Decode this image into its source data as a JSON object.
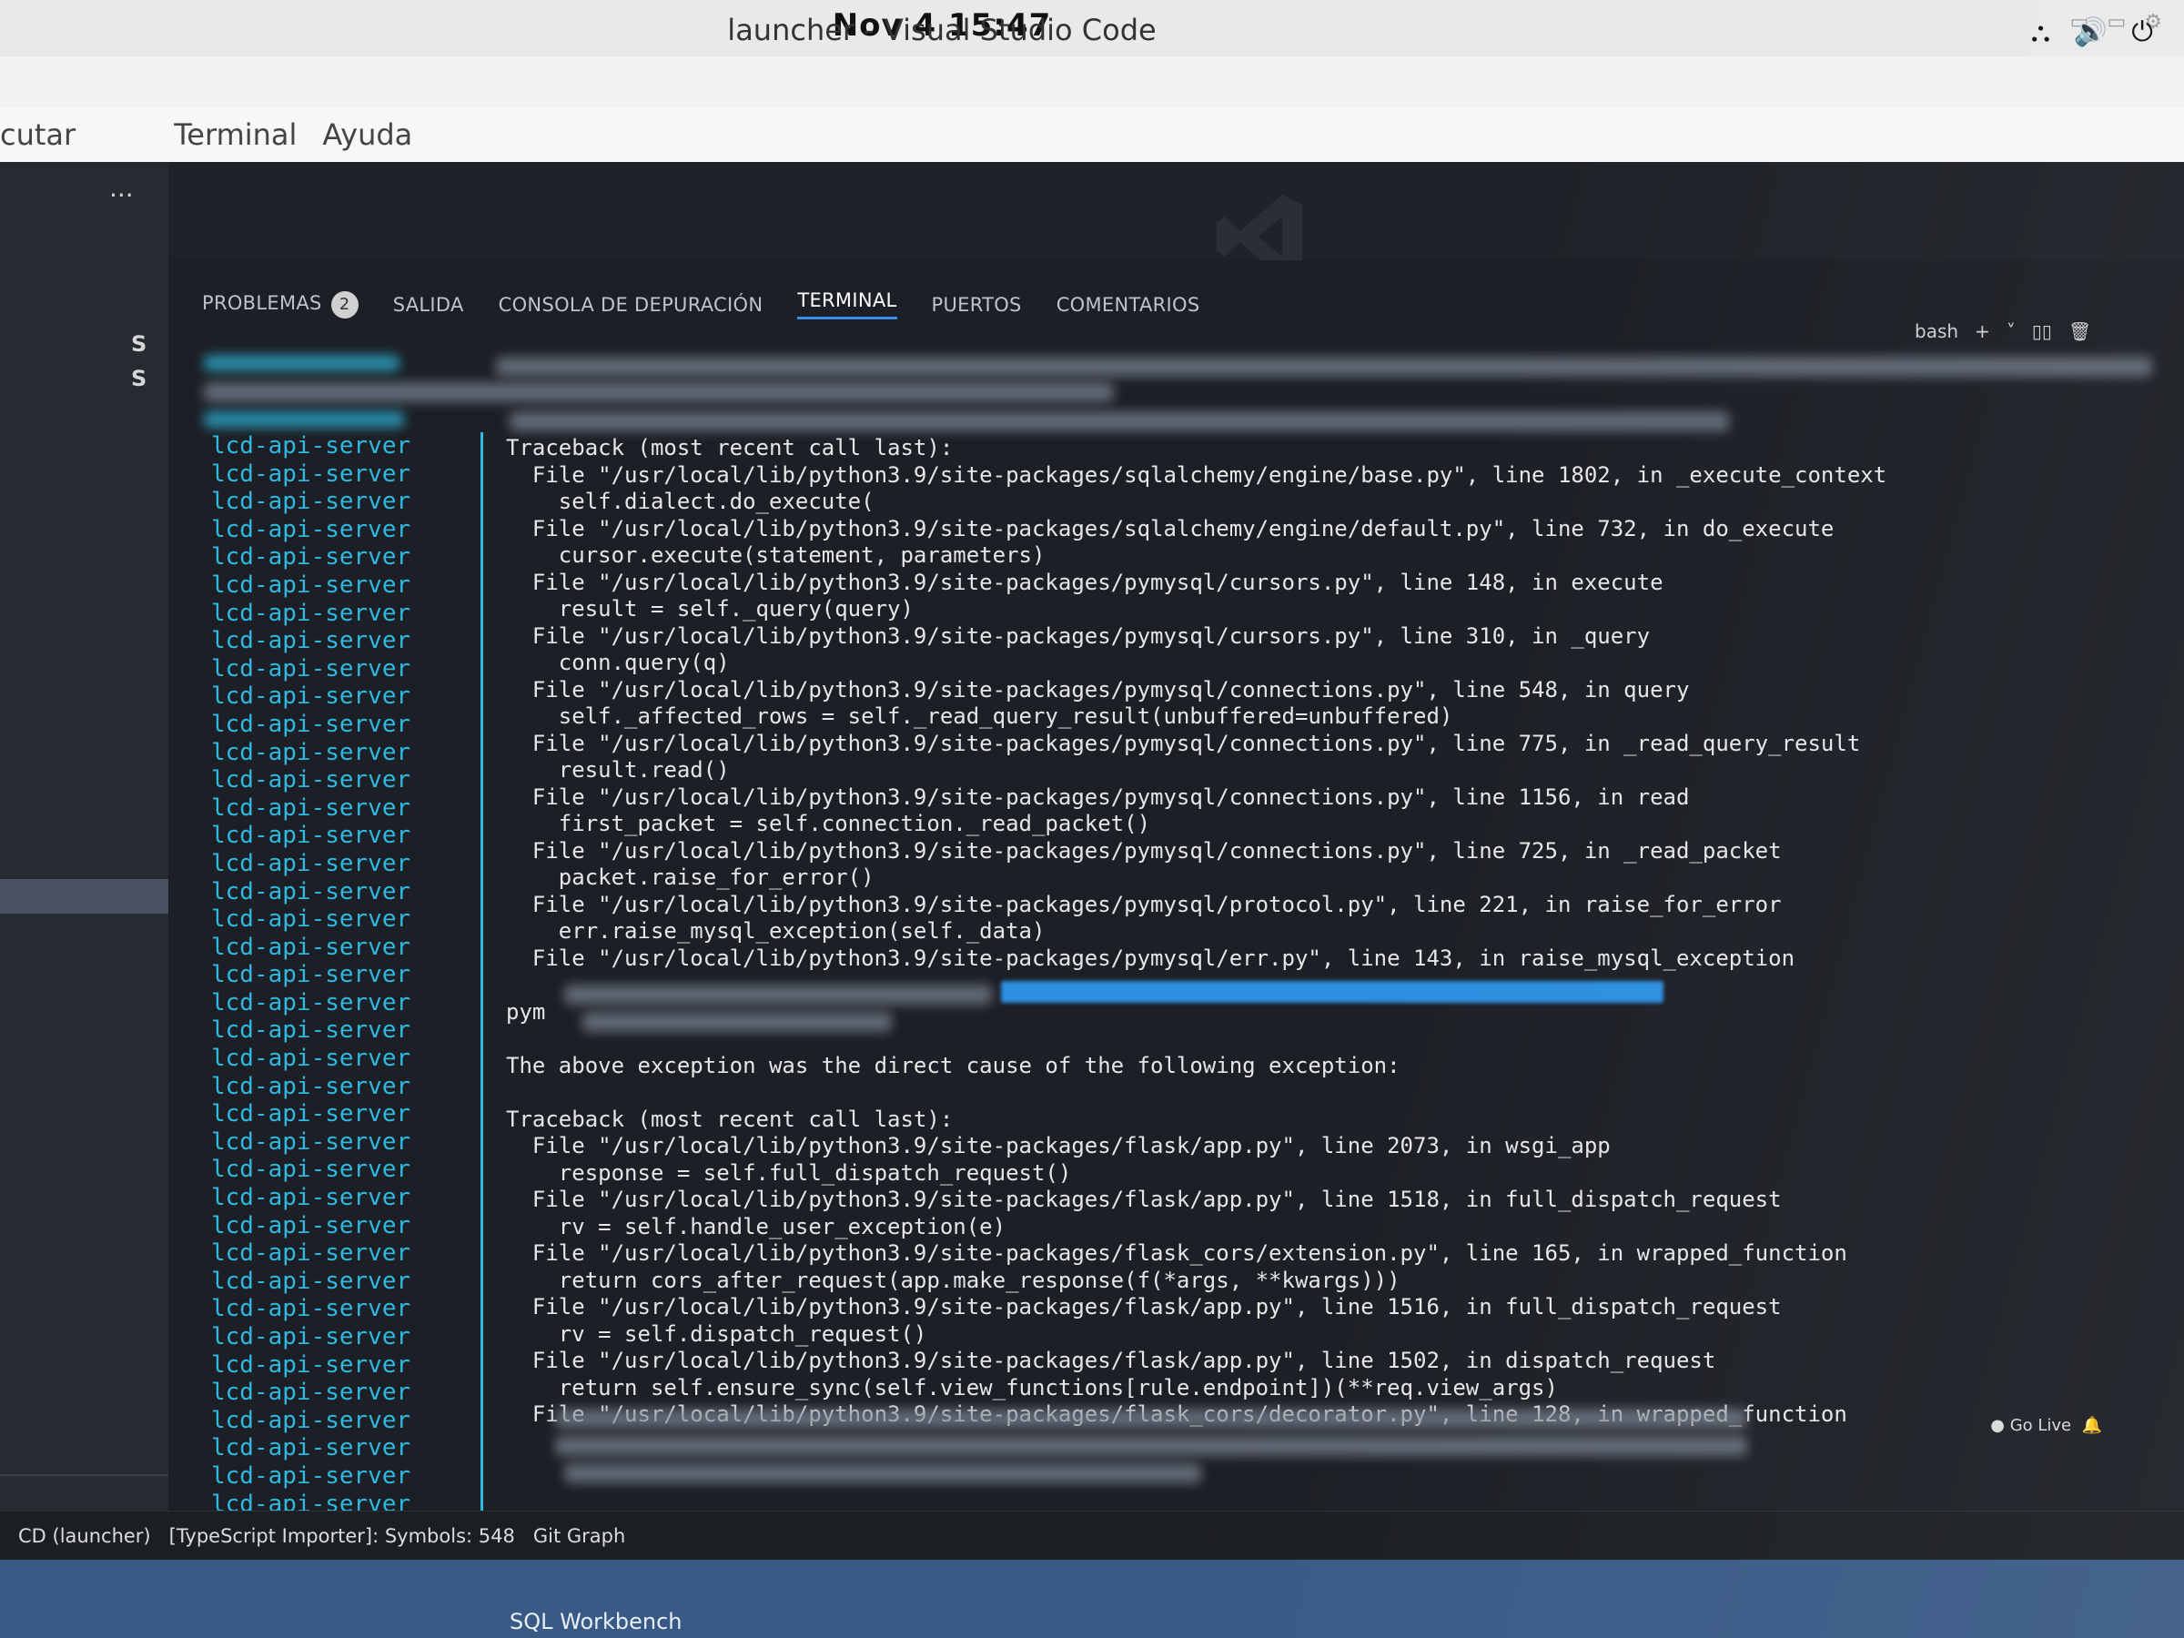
{
  "clock": "Nov 4  15:47",
  "window_title": "launcher - Visual Studio Code",
  "menu": [
    "cutar",
    "Terminal",
    "Ayuda"
  ],
  "sidebar": {
    "more": "...",
    "letters": [
      "S",
      "S"
    ]
  },
  "panel": {
    "tabs": [
      {
        "label": "PROBLEMAS",
        "badge": "2"
      },
      {
        "label": "SALIDA"
      },
      {
        "label": "CONSOLA DE DEPURACIÓN"
      },
      {
        "label": "TERMINAL",
        "active": true
      },
      {
        "label": "PUERTOS"
      },
      {
        "label": "COMENTARIOS"
      }
    ],
    "tools": {
      "shell": "bash",
      "add": "+",
      "chevron": "˅",
      "split": "▯▯",
      "trash": "🗑"
    }
  },
  "terminal": {
    "prefix": "lcd-api-server",
    "prefix_count": 40,
    "lines": [
      "Traceback (most recent call last):",
      "  File \"/usr/local/lib/python3.9/site-packages/sqlalchemy/engine/base.py\", line 1802, in _execute_context",
      "    self.dialect.do_execute(",
      "  File \"/usr/local/lib/python3.9/site-packages/sqlalchemy/engine/default.py\", line 732, in do_execute",
      "    cursor.execute(statement, parameters)",
      "  File \"/usr/local/lib/python3.9/site-packages/pymysql/cursors.py\", line 148, in execute",
      "    result = self._query(query)",
      "  File \"/usr/local/lib/python3.9/site-packages/pymysql/cursors.py\", line 310, in _query",
      "    conn.query(q)",
      "  File \"/usr/local/lib/python3.9/site-packages/pymysql/connections.py\", line 548, in query",
      "    self._affected_rows = self._read_query_result(unbuffered=unbuffered)",
      "  File \"/usr/local/lib/python3.9/site-packages/pymysql/connections.py\", line 775, in _read_query_result",
      "    result.read()",
      "  File \"/usr/local/lib/python3.9/site-packages/pymysql/connections.py\", line 1156, in read",
      "    first_packet = self.connection._read_packet()",
      "  File \"/usr/local/lib/python3.9/site-packages/pymysql/connections.py\", line 725, in _read_packet",
      "    packet.raise_for_error()",
      "  File \"/usr/local/lib/python3.9/site-packages/pymysql/protocol.py\", line 221, in raise_for_error",
      "    err.raise_mysql_exception(self._data)",
      "  File \"/usr/local/lib/python3.9/site-packages/pymysql/err.py\", line 143, in raise_mysql_exception",
      "",
      "pym",
      "",
      "The above exception was the direct cause of the following exception:",
      "",
      "Traceback (most recent call last):",
      "  File \"/usr/local/lib/python3.9/site-packages/flask/app.py\", line 2073, in wsgi_app",
      "    response = self.full_dispatch_request()",
      "  File \"/usr/local/lib/python3.9/site-packages/flask/app.py\", line 1518, in full_dispatch_request",
      "    rv = self.handle_user_exception(e)",
      "  File \"/usr/local/lib/python3.9/site-packages/flask_cors/extension.py\", line 165, in wrapped_function",
      "    return cors_after_request(app.make_response(f(*args, **kwargs)))",
      "  File \"/usr/local/lib/python3.9/site-packages/flask/app.py\", line 1516, in full_dispatch_request",
      "    rv = self.dispatch_request()",
      "  File \"/usr/local/lib/python3.9/site-packages/flask/app.py\", line 1502, in dispatch_request",
      "    return self.ensure_sync(self.view_functions[rule.endpoint])(**req.view_args)",
      "  File \"/usr/local/lib/python3.9/site-packages/flask_cors/decorator.py\", line 128, in wrapped_function"
    ]
  },
  "statusbar": {
    "items": [
      "CD (launcher)",
      "[TypeScript Importer]: Symbols: 548",
      "Git Graph"
    ],
    "golive": "Go Live"
  },
  "dock": {
    "app_label": "SQL Workbench"
  }
}
